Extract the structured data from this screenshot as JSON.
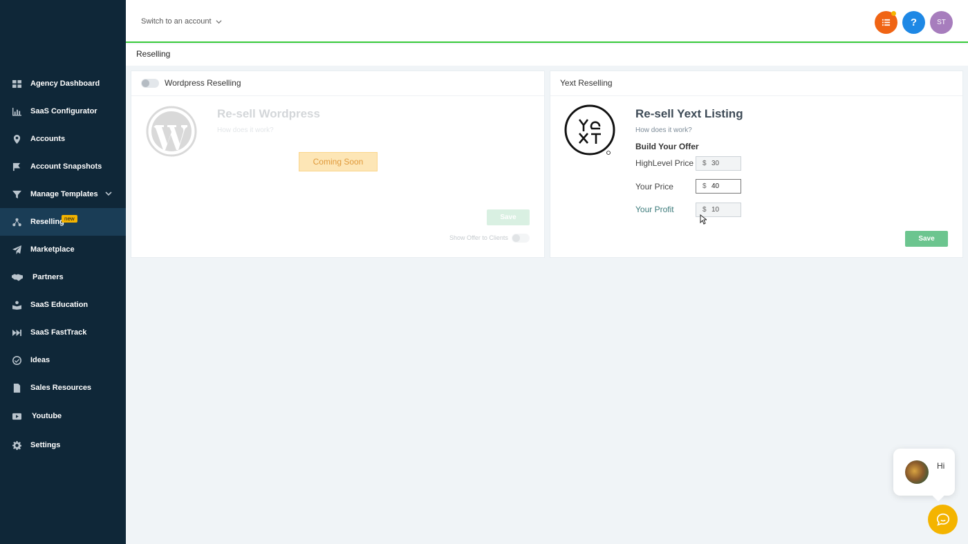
{
  "sidebar": {
    "items": [
      {
        "label": "Agency Dashboard",
        "icon": "dashboard-icon"
      },
      {
        "label": "SaaS Configurator",
        "icon": "chart-icon"
      },
      {
        "label": "Accounts",
        "icon": "map-pin-icon"
      },
      {
        "label": "Account Snapshots",
        "icon": "snapshot-icon"
      },
      {
        "label": "Manage Templates",
        "icon": "filter-icon"
      },
      {
        "label": "Reselling",
        "icon": "network-icon",
        "badge": "new",
        "active": true
      },
      {
        "label": "Marketplace",
        "icon": "paper-plane-icon"
      },
      {
        "label": "Partners",
        "icon": "handshake-icon"
      },
      {
        "label": "SaaS Education",
        "icon": "education-icon"
      },
      {
        "label": "SaaS FastTrack",
        "icon": "fast-forward-icon"
      },
      {
        "label": "Ideas",
        "icon": "check-circle-icon"
      },
      {
        "label": "Sales Resources",
        "icon": "document-icon"
      },
      {
        "label": "Youtube",
        "icon": "youtube-icon"
      },
      {
        "label": "Settings",
        "icon": "gear-icon"
      }
    ]
  },
  "topbar": {
    "switch_account": "Switch to an account",
    "help_label": "?",
    "avatar_initials": "ST"
  },
  "page": {
    "title": "Reselling"
  },
  "wordpress": {
    "card_title": "Wordpress Reselling",
    "heading": "Re-sell Wordpress",
    "how_link": "How does it work?",
    "coming_soon": "Coming Soon",
    "save_label": "Save",
    "show_offer": "Show Offer to Clients"
  },
  "yext": {
    "card_title": "Yext Reselling",
    "heading": "Re-sell Yext Listing",
    "how_link": "How does it work?",
    "build_offer": "Build Your Offer",
    "currency": "$",
    "highlevel_label": "HighLevel Price",
    "highlevel_value": "30",
    "your_price_label": "Your Price",
    "your_price_value": "40",
    "your_profit_label": "Your Profit",
    "your_profit_value": "10",
    "save_label": "Save"
  },
  "chat": {
    "greeting": "Hi"
  },
  "colors": {
    "sidebar_bg": "#0f2738",
    "active_item_bg": "#1a3d56",
    "accent_green": "#37ca37",
    "save_green": "#6cc58f",
    "badge_yellow": "#f4b400"
  }
}
